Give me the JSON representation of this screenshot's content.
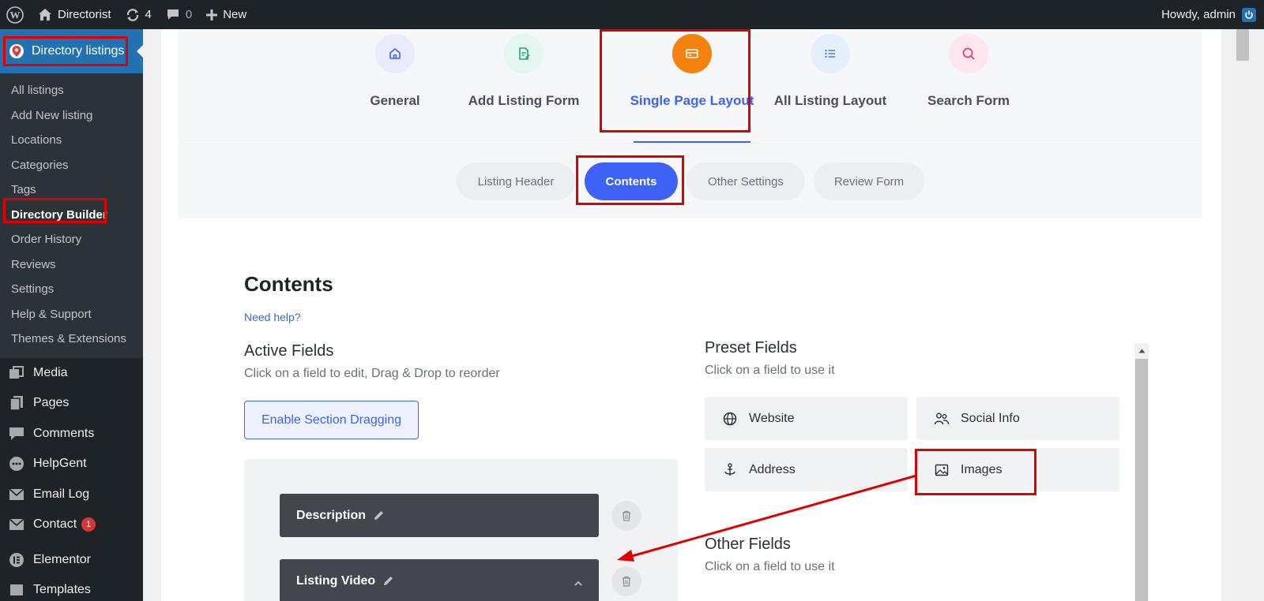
{
  "adminbar": {
    "site_name": "Directorist",
    "updates_count": "4",
    "comments_count": "0",
    "new_label": "New",
    "howdy": "Howdy, admin"
  },
  "sidebar": {
    "active_menu": "Directory listings",
    "submenu": [
      "All listings",
      "Add New listing",
      "Locations",
      "Categories",
      "Tags",
      "Directory Builder",
      "Order History",
      "Reviews",
      "Settings",
      "Help & Support",
      "Themes & Extensions"
    ],
    "menu": [
      {
        "label": "Media",
        "icon": "media-icon"
      },
      {
        "label": "Pages",
        "icon": "pages-icon"
      },
      {
        "label": "Comments",
        "icon": "comments-icon"
      },
      {
        "label": "HelpGent",
        "icon": "helpgent-icon"
      },
      {
        "label": "Email Log",
        "icon": "email-icon"
      },
      {
        "label": "Contact",
        "icon": "contact-icon",
        "badge": "1"
      },
      {
        "label": "Elementor",
        "icon": "elementor-icon"
      },
      {
        "label": "Templates",
        "icon": "templates-icon"
      }
    ]
  },
  "topnav": {
    "tabs": [
      {
        "label": "General",
        "icon": "home-icon",
        "color": "#e9ecfd"
      },
      {
        "label": "Add Listing Form",
        "icon": "form-icon",
        "color": "#e3f6ef"
      },
      {
        "label": "Single Page Layout",
        "icon": "card-icon",
        "color": "#f5820f"
      },
      {
        "label": "All Listing Layout",
        "icon": "list-icon",
        "color": "#e5eefb"
      },
      {
        "label": "Search Form",
        "icon": "search-icon",
        "color": "#fde6ee"
      }
    ],
    "active": "Single Page Layout"
  },
  "subnav": {
    "pills": [
      "Listing Header",
      "Contents",
      "Other Settings",
      "Review Form"
    ],
    "active": "Contents"
  },
  "contents": {
    "title": "Contents",
    "help_link": "Need help?",
    "active_fields": {
      "title": "Active Fields",
      "subtitle": "Click on a field to edit, Drag & Drop to reorder",
      "drag_button": "Enable Section Dragging",
      "fields": [
        "Description",
        "Listing Video"
      ]
    },
    "preset_fields": {
      "title": "Preset Fields",
      "subtitle": "Click on a field to use it",
      "items": [
        "Website",
        "Social Info",
        "Address",
        "Images"
      ]
    },
    "other_fields": {
      "title": "Other Fields",
      "subtitle": "Click on a field to use it"
    }
  },
  "colors": {
    "accent": "#3e62f5",
    "highlight": "#e00000",
    "wp_blue": "#2271b1",
    "sidebar_bg": "#1d2327"
  }
}
